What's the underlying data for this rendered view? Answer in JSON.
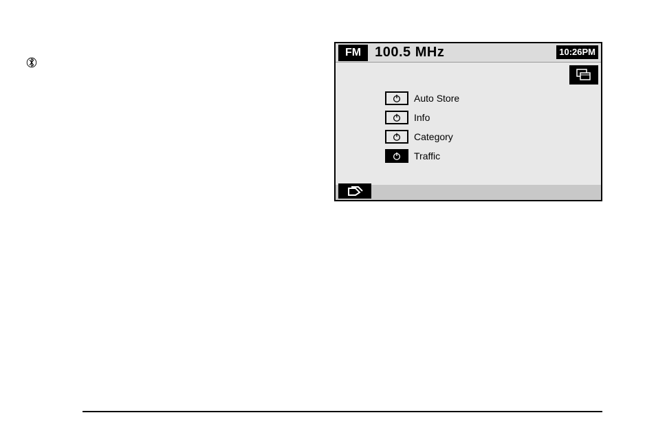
{
  "header": {
    "band": "FM",
    "frequency": "100.5 MHz",
    "clock": "10:26PM"
  },
  "menu": [
    {
      "label": "Auto Store",
      "on": false
    },
    {
      "label": "Info",
      "on": false
    },
    {
      "label": "Category",
      "on": false
    },
    {
      "label": "Traffic",
      "on": true
    }
  ],
  "icons": {
    "bluetooth": "bluetooth-icon",
    "layers": "layers-icon",
    "tag": "tag-icon"
  }
}
